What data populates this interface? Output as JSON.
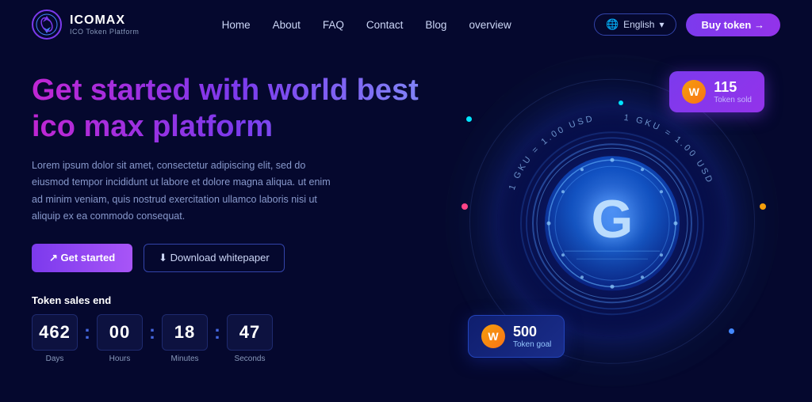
{
  "brand": {
    "name": "ICOMAX",
    "tagline": "ICO Token Platform"
  },
  "nav": {
    "links": [
      {
        "label": "Home",
        "key": "home"
      },
      {
        "label": "About",
        "key": "about"
      },
      {
        "label": "FAQ",
        "key": "faq"
      },
      {
        "label": "Contact",
        "key": "contact"
      },
      {
        "label": "Blog",
        "key": "blog"
      },
      {
        "label": "overview",
        "key": "overview"
      }
    ],
    "lang_label": "English",
    "buy_label": "Buy token →"
  },
  "hero": {
    "title": "Get started with world best ico max platform",
    "desc": "Lorem ipsum dolor sit amet, consectetur adipiscing elit, sed do eiusmod tempor incididunt ut labore et dolore magna aliqua. ut enim ad minim veniam, quis nostrud exercitation ullamco laboris nisi ut aliquip ex ea commodo consequat.",
    "btn_get_started": "↗ Get started",
    "btn_whitepaper": "⬇ Download whitepaper"
  },
  "token_sales": {
    "label": "Token sales end",
    "countdown": {
      "days": "462",
      "hours": "00",
      "minutes": "18",
      "seconds": "47",
      "labels": {
        "days": "Days",
        "hours": "Hours",
        "minutes": "Minutes",
        "seconds": "Seconds"
      }
    }
  },
  "cards": {
    "token_sold": {
      "number": "115",
      "label": "Token sold"
    },
    "token_goal": {
      "number": "500",
      "label": "Token goal"
    }
  },
  "coin": {
    "orbit_text": "1 GKU = 1.00 USD"
  }
}
